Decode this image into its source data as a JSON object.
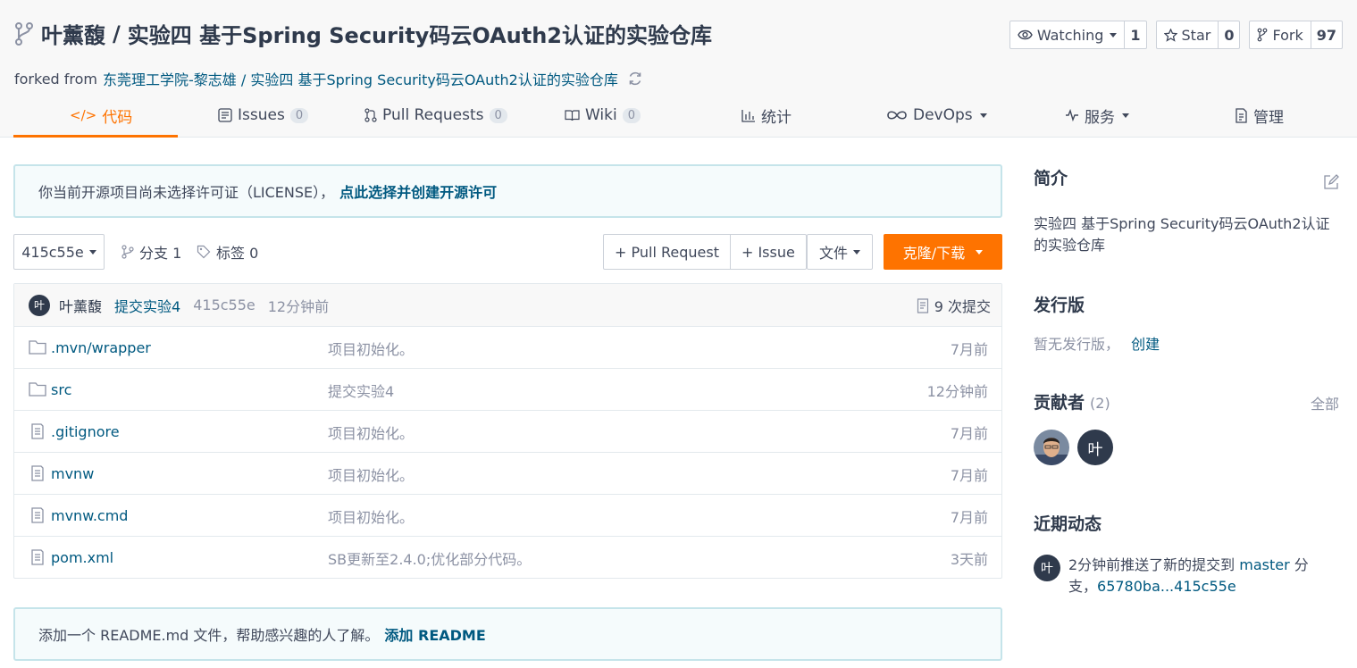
{
  "repo": {
    "owner": "叶薰馥",
    "separator": "/",
    "name": "实验四 基于Spring Security码云OAuth2认证的实验仓库",
    "forked_prefix": "forked from",
    "forked_source": "东莞理工学院-黎志雄 / 实验四 基于Spring Security码云OAuth2认证的实验仓库"
  },
  "actions": {
    "watch_label": "Watching",
    "watch_count": "1",
    "star_label": "Star",
    "star_count": "0",
    "fork_label": "Fork",
    "fork_count": "97"
  },
  "tabs": [
    {
      "label": "代码"
    },
    {
      "label": "Issues",
      "count": "0"
    },
    {
      "label": "Pull Requests",
      "count": "0"
    },
    {
      "label": "Wiki",
      "count": "0"
    },
    {
      "label": "统计"
    },
    {
      "label": "DevOps"
    },
    {
      "label": "服务"
    },
    {
      "label": "管理"
    }
  ],
  "license": {
    "text": "你当前开源项目尚未选择许可证（LICENSE），",
    "link": "点此选择并创建开源许可"
  },
  "toolbar": {
    "branch": "415c55e",
    "branches": "分支 1",
    "tags": "标签 0",
    "pull_request": "+ Pull Request",
    "issue": "+ Issue",
    "file": "文件",
    "clone": "克隆/下载"
  },
  "commit": {
    "avatar": "叶",
    "author": "叶薰馥",
    "message": "提交实验4",
    "hash": "415c55e",
    "time": "12分钟前",
    "count": "9 次提交"
  },
  "files": [
    {
      "type": "folder",
      "name": ".mvn/wrapper",
      "message": "项目初始化。",
      "time": "7月前"
    },
    {
      "type": "folder",
      "name": "src",
      "message": "提交实验4",
      "time": "12分钟前"
    },
    {
      "type": "file",
      "name": ".gitignore",
      "message": "项目初始化。",
      "time": "7月前"
    },
    {
      "type": "file",
      "name": "mvnw",
      "message": "项目初始化。",
      "time": "7月前"
    },
    {
      "type": "file",
      "name": "mvnw.cmd",
      "message": "项目初始化。",
      "time": "7月前"
    },
    {
      "type": "file",
      "name": "pom.xml",
      "message": "SB更新至2.4.0;优化部分代码。",
      "time": "3天前"
    }
  ],
  "readme": {
    "text": "添加一个 README.md 文件，帮助感兴趣的人了解。",
    "link": "添加 README"
  },
  "sidebar": {
    "intro_title": "简介",
    "intro_text": "实验四 基于Spring Security码云OAuth2认证的实验仓库",
    "release_title": "发行版",
    "release_text": "暂无发行版，",
    "release_link": "创建",
    "contrib_title": "贡献者",
    "contrib_count": "(2)",
    "contrib_all": "全部",
    "contrib_avatar": "叶",
    "activity_title": "近期动态",
    "activity_avatar": "叶",
    "activity_prefix": "2分钟前推送了新的提交到",
    "activity_branch": "master",
    "activity_mid": "分支，",
    "activity_range": "65780ba...415c55e"
  },
  "colors": {
    "accent": "#fe7300",
    "link": "#005980",
    "text": "#40485b",
    "muted": "#8c92a4"
  }
}
